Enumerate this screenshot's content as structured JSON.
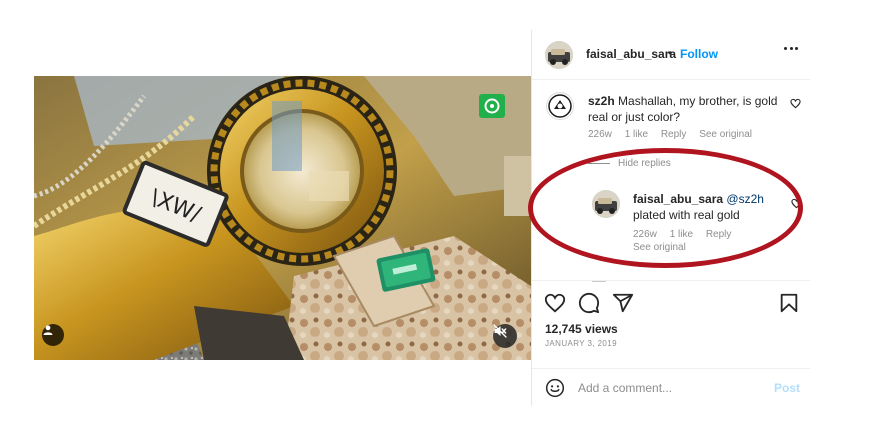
{
  "post": {
    "media": {
      "user_tag_icon": "person-icon",
      "mute_icon": "speaker-muted-icon",
      "badge_icon": "camera-logo-icon",
      "colors": {
        "gold": "#c9a23a",
        "dark_gold": "#7a5a18",
        "camo": "#cdb8a0",
        "green": "#2fb47a"
      }
    },
    "header": {
      "username": "faisal_abu_sara",
      "separator": "•",
      "follow_label": "Follow",
      "more_icon": "more-horizontal-icon"
    },
    "comments": [
      {
        "username": "sz2h",
        "text": "Mashallah, my brother, is gold real or just color?",
        "age": "226w",
        "likes": "1 like",
        "reply_label": "Reply",
        "see_original": "See original",
        "hide_replies": "Hide replies",
        "replies": [
          {
            "username": "faisal_abu_sara",
            "mention": "@sz2h",
            "text": "plated with real gold",
            "age": "226w",
            "likes": "1 like",
            "reply_label": "Reply",
            "see_original": "See original"
          }
        ]
      }
    ],
    "stats": {
      "views": "12,745 views",
      "date": "JANUARY 3, 2019"
    },
    "add_comment": {
      "placeholder": "Add a comment...",
      "post_label": "Post"
    }
  },
  "colors": {
    "follow_blue": "#0095f6",
    "post_disabled": "#b2dffc",
    "mention": "#00376b",
    "highlight_red": "#b0151f"
  }
}
